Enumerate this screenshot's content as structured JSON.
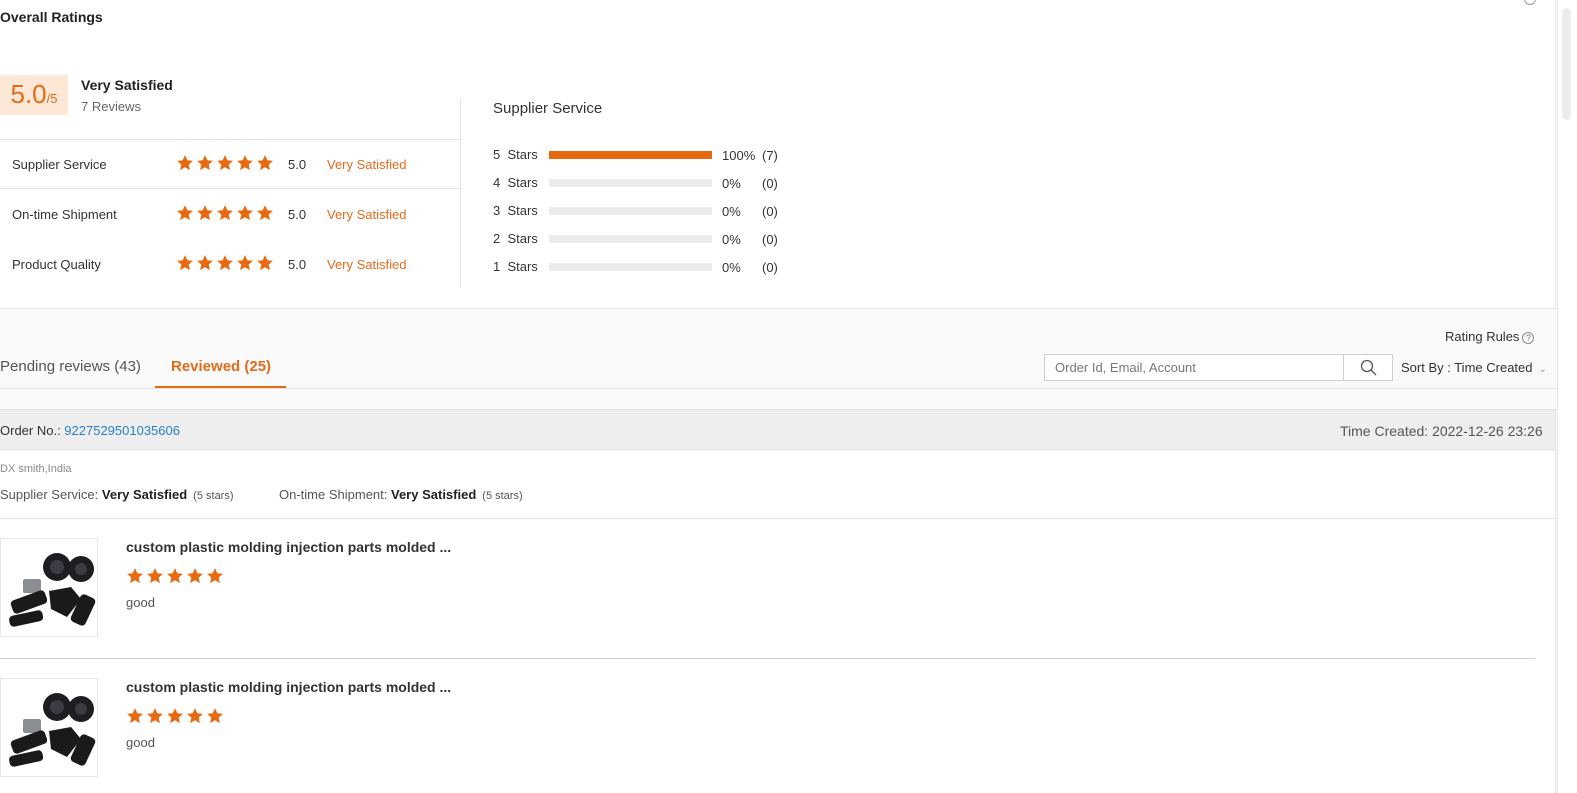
{
  "colors": {
    "accent": "#e8690f",
    "link": "#2a7fc4"
  },
  "overall": {
    "title": "Overall Ratings",
    "score": "5.0",
    "score_max": "/5",
    "label": "Very Satisfied",
    "reviews": "7 Reviews"
  },
  "ratings": [
    {
      "label": "Supplier Service",
      "stars": 5,
      "value": "5.0",
      "text": "Very Satisfied"
    },
    {
      "label": "On-time Shipment",
      "stars": 5,
      "value": "5.0",
      "text": "Very Satisfied"
    },
    {
      "label": "Product Quality",
      "stars": 5,
      "value": "5.0",
      "text": "Very Satisfied"
    }
  ],
  "distribution": {
    "title": "Supplier Service",
    "rows": [
      {
        "label": "5  Stars",
        "percent": "100%",
        "fraction": 1.0,
        "count": "(7)"
      },
      {
        "label": "4  Stars",
        "percent": "0%",
        "fraction": 0,
        "count": "(0)"
      },
      {
        "label": "3  Stars",
        "percent": "0%",
        "fraction": 0,
        "count": "(0)"
      },
      {
        "label": "2  Stars",
        "percent": "0%",
        "fraction": 0,
        "count": "(0)"
      },
      {
        "label": "1  Stars",
        "percent": "0%",
        "fraction": 0,
        "count": "(0)"
      }
    ]
  },
  "toolbar": {
    "rating_rules": "Rating Rules",
    "help_glyph": "?",
    "search_placeholder": "Order Id, Email, Account",
    "sort_by": "Sort By : Time Created"
  },
  "tabs": {
    "pending": "Pending reviews (43)",
    "reviewed": "Reviewed (25)"
  },
  "order": {
    "order_no_label": "Order No.: ",
    "order_no": "9227529501035606",
    "time_created": "Time Created: 2022-12-26 23:26",
    "buyer": "DX smith,India",
    "supplier_service_label": "Supplier Service: ",
    "supplier_service_value": "Very Satisfied",
    "supplier_service_stars": "(5 stars)",
    "shipment_label": "On-time Shipment: ",
    "shipment_value": "Very Satisfied",
    "shipment_stars": "(5 stars)",
    "products": [
      {
        "title": "custom plastic molding injection parts molded ...",
        "stars": 5,
        "comment": "good"
      },
      {
        "title": "custom plastic molding injection parts molded ...",
        "stars": 5,
        "comment": "good"
      }
    ]
  }
}
